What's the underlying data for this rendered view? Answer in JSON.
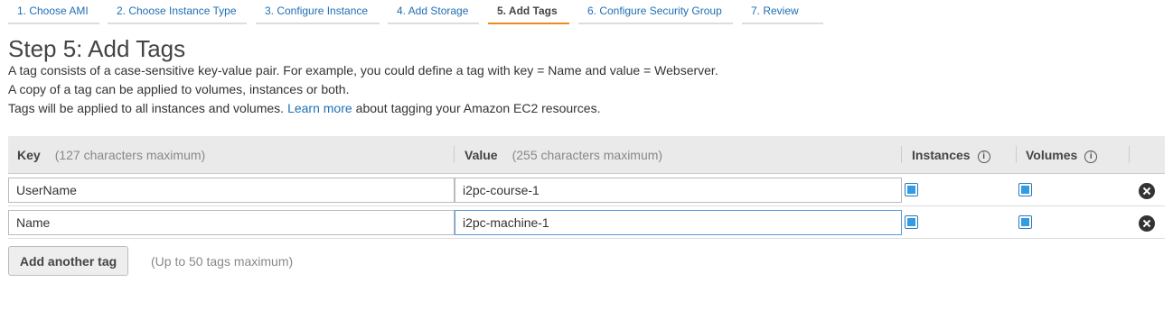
{
  "tabs": [
    {
      "label": "1. Choose AMI"
    },
    {
      "label": "2. Choose Instance Type"
    },
    {
      "label": "3. Configure Instance"
    },
    {
      "label": "4. Add Storage"
    },
    {
      "label": "5. Add Tags",
      "active": true
    },
    {
      "label": "6. Configure Security Group"
    },
    {
      "label": "7. Review"
    }
  ],
  "page": {
    "title": "Step 5: Add Tags",
    "line1": "A tag consists of a case-sensitive key-value pair. For example, you could define a tag with key = Name and value = Webserver.",
    "line2": "A copy of a tag can be applied to volumes, instances or both.",
    "line3_before": "Tags will be applied to all instances and volumes.",
    "line3_link": "Learn more",
    "line3_after": "about tagging your Amazon EC2 resources."
  },
  "table": {
    "headers": {
      "key": "Key",
      "key_hint": "(127 characters maximum)",
      "value": "Value",
      "value_hint": "(255 characters maximum)",
      "instances": "Instances",
      "volumes": "Volumes",
      "info_icon": "i"
    },
    "rows": [
      {
        "key": "UserName",
        "value": "i2pc-course-1",
        "instances": true,
        "volumes": true
      },
      {
        "key": "Name",
        "value": "i2pc-machine-1",
        "instances": true,
        "volumes": true
      }
    ]
  },
  "actions": {
    "add_tag_label": "Add another tag",
    "add_tag_note": "(Up to 50 tags maximum)"
  },
  "colors": {
    "accent_tab": "#ec8c20",
    "link": "#1f6fb5",
    "checkbox": "#2f9ce4"
  }
}
